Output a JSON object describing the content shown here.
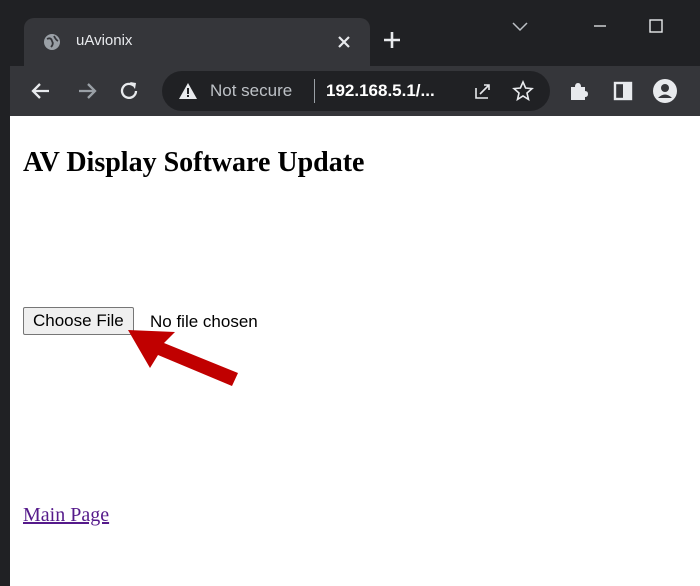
{
  "browser": {
    "tab": {
      "title": "uAvionix",
      "favicon": "globe-icon"
    },
    "address": {
      "security_label": "Not secure",
      "url": "192.168.5.1/..."
    }
  },
  "page": {
    "heading": "AV Display Software Update",
    "file_input": {
      "button_label": "Choose File",
      "status": "No file chosen"
    },
    "link": "Main Page"
  },
  "annotation": {
    "type": "arrow",
    "color": "#c00000",
    "points_to": "choose-file-button"
  },
  "colors": {
    "chrome_dark": "#202124",
    "chrome_mid": "#35363a",
    "visited_link": "#551a8b"
  }
}
